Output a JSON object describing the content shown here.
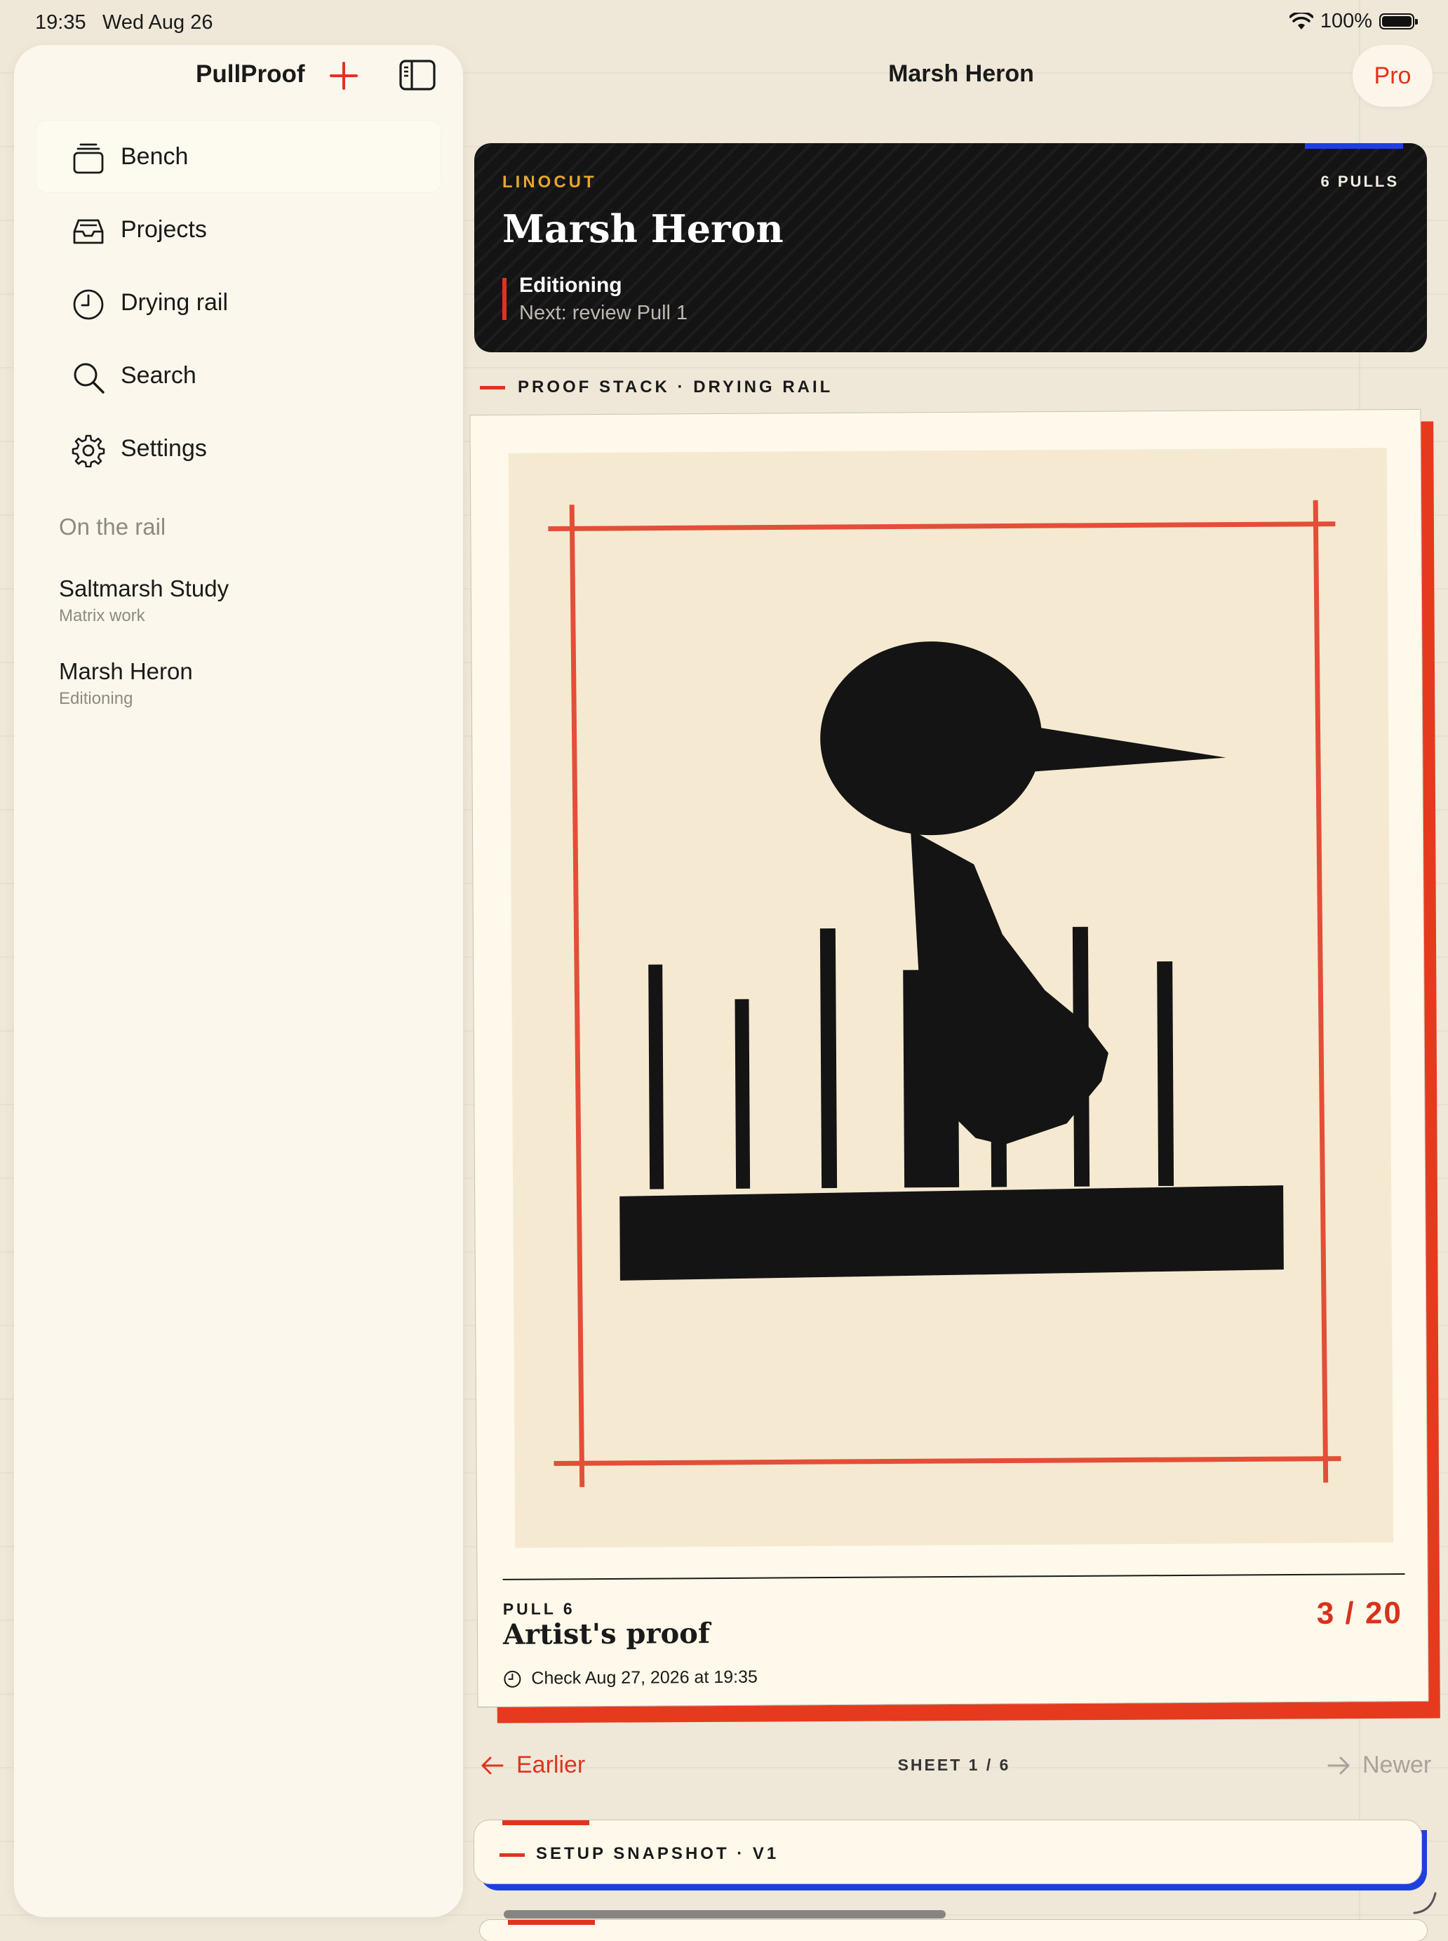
{
  "status_bar": {
    "time": "19:35",
    "date": "Wed Aug 26",
    "battery": "100%"
  },
  "sidebar": {
    "title": "PullProof",
    "nav": [
      {
        "label": "Bench",
        "icon": "stack-icon",
        "selected": true
      },
      {
        "label": "Projects",
        "icon": "tray-icon"
      },
      {
        "label": "Drying rail",
        "icon": "clock-icon"
      },
      {
        "label": "Search",
        "icon": "search-icon"
      },
      {
        "label": "Settings",
        "icon": "gear-icon"
      }
    ],
    "section_title": "On the rail",
    "rail_items": [
      {
        "title": "Saltmarsh Study",
        "subtitle": "Matrix work"
      },
      {
        "title": "Marsh Heron",
        "subtitle": "Editioning"
      }
    ]
  },
  "header": {
    "title": "Marsh Heron",
    "pro_label": "Pro"
  },
  "hero": {
    "kind": "LINOCUT",
    "pulls": "6  PULLS",
    "title": "Marsh Heron",
    "status": "Editioning",
    "next": "Next: review Pull 1"
  },
  "proof_section": {
    "label": "PROOF STACK · DRYING RAIL"
  },
  "proof": {
    "pull_number": "PULL  6",
    "title": "Artist's proof",
    "edition": "3 / 20",
    "check": "Check Aug 27, 2026 at 19:35"
  },
  "pager": {
    "earlier": "Earlier",
    "sheet": "SHEET  1  /  6",
    "newer": "Newer"
  },
  "snapshot": {
    "label": "SETUP SNAPSHOT · V1"
  },
  "colors": {
    "accent": "#E0331E",
    "blue": "#1E3FE0",
    "ink": "#141414",
    "paper": "#FEF9EA",
    "mustard": "#E4A72E"
  }
}
